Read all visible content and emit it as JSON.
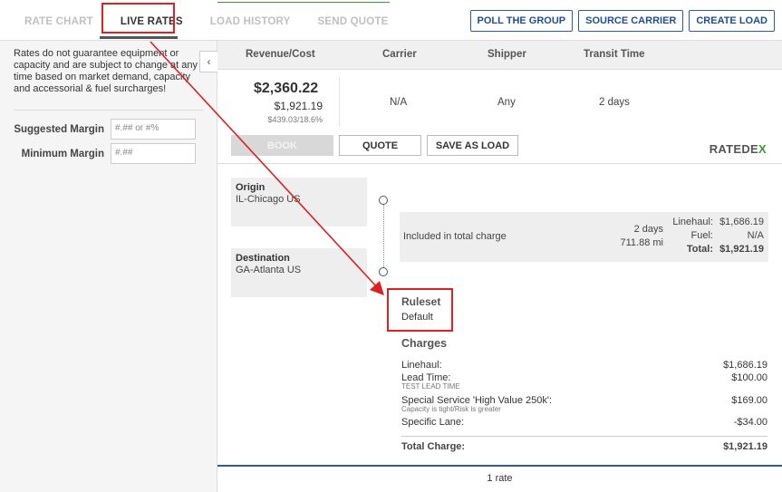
{
  "tabs": [
    "RATE CHART",
    "LIVE RATES",
    "LOAD HISTORY",
    "SEND QUOTE"
  ],
  "top_buttons": [
    "POLL THE GROUP",
    "SOURCE CARRIER",
    "CREATE LOAD"
  ],
  "left": {
    "disclaimer": "Rates do not guarantee equipment or capacity and are subject to change at any time based on market demand, capacity and accessorial & fuel surcharges!",
    "suggested_margin_label": "Suggested Margin",
    "suggested_margin_placeholder": "#.## or #%",
    "minimum_margin_label": "Minimum Margin",
    "minimum_margin_placeholder": "#.##",
    "collapse_glyph": "‹"
  },
  "columns": [
    "Revenue/Cost",
    "Carrier",
    "Shipper",
    "Transit Time"
  ],
  "rate": {
    "revenue": "$2,360.22",
    "cost": "$1,921.19",
    "margin": "$439.03/18.6%",
    "carrier": "N/A",
    "shipper": "Any",
    "transit": "2 days"
  },
  "actions": {
    "book": "BOOK",
    "quote": "QUOTE",
    "save": "SAVE AS LOAD"
  },
  "logo": {
    "main": "RATEDE",
    "accent": "X"
  },
  "origin": {
    "label": "Origin",
    "value": "IL-Chicago US"
  },
  "destination": {
    "label": "Destination",
    "value": "GA-Atlanta US"
  },
  "summary": {
    "included": "Included in total charge",
    "days": "2 days",
    "miles": "711.88 mi",
    "linehaul_label": "Linehaul:",
    "linehaul": "$1,686.19",
    "fuel_label": "Fuel:",
    "fuel": "N/A",
    "total_label": "Total:",
    "total": "$1,921.19"
  },
  "ruleset": {
    "label": "Ruleset",
    "value": "Default"
  },
  "charges": {
    "title": "Charges",
    "items": [
      {
        "label": "Linehaul:",
        "amount": "$1,686.19",
        "note": ""
      },
      {
        "label": "Lead Time:",
        "amount": "$100.00",
        "note": "TEST LEAD TIME"
      },
      {
        "label": "Special Service 'High Value 250k':",
        "amount": "$169.00",
        "note": "Capacity is tight/Risk is greater"
      },
      {
        "label": "Specific Lane:",
        "amount": "-$34.00",
        "note": ""
      }
    ],
    "total_label": "Total Charge:",
    "total": "$1,921.19"
  },
  "rate_count": "1 rate",
  "colors": {
    "accent_blue": "#2b5d9b",
    "annotation_red": "#e02020",
    "logo_green": "#3a9a3a"
  }
}
